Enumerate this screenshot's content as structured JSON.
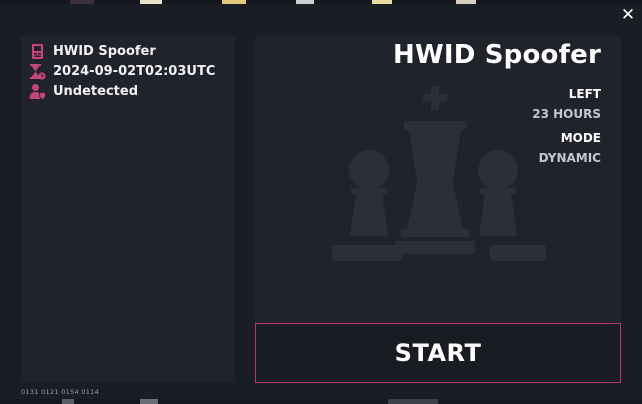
{
  "window": {
    "close_label": "✕"
  },
  "info_panel": {
    "product_name": "HWID Spoofer",
    "timestamp": "2024-09-02T02:03UTC",
    "status": "Undetected",
    "icons": [
      "device-icon",
      "hourglass-icon",
      "user-shield-icon"
    ]
  },
  "footer": {
    "version_text": "0131 0121 0154 0114"
  },
  "product": {
    "title": "HWID Spoofer",
    "left_label": "LEFT",
    "left_value": "23 HOURS",
    "mode_label": "MODE",
    "mode_value": "DYNAMIC"
  },
  "actions": {
    "start_label": "START"
  },
  "colors": {
    "accent": "#c2467a",
    "background": "#1b1d25",
    "panel": "#20232c",
    "art": "#2c2f39"
  }
}
